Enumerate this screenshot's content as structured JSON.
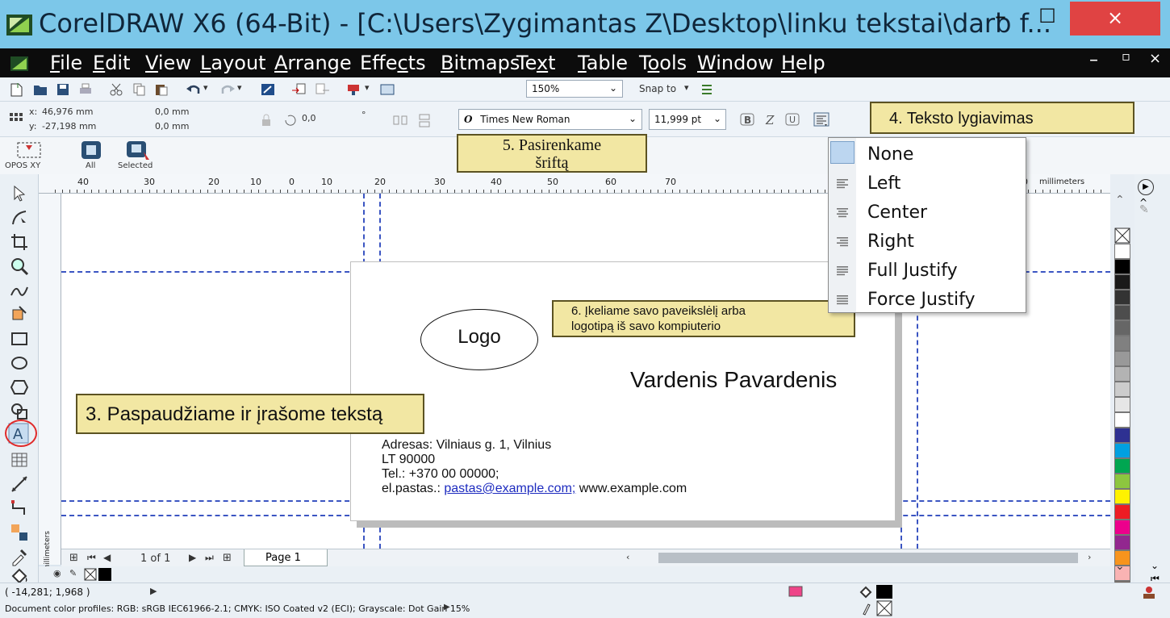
{
  "window": {
    "title": "CorelDRAW X6 (64-Bit) - [C:\\Users\\Zygimantas Z\\Desktop\\linku tekstai\\darb f...",
    "minimize": "–",
    "maximize": "☐",
    "close": "×"
  },
  "menu": {
    "items": [
      "File",
      "Edit",
      "View",
      "Layout",
      "Arrange",
      "Effects",
      "Bitmaps",
      "Text",
      "Table",
      "Tools",
      "Window",
      "Help"
    ],
    "mnemonics": [
      "F",
      "E",
      "V",
      "L",
      "A",
      "c",
      "B",
      "x",
      "T",
      "o",
      "W",
      "H"
    ],
    "doc_min": "–",
    "doc_restore": "▫",
    "doc_close": "×"
  },
  "standard_toolbar": {
    "zoom": "150%",
    "snap_to": "Snap to"
  },
  "property_bar": {
    "x_label": "x:",
    "x_value": "46,976 mm",
    "y_label": "y:",
    "y_value": "-27,198 mm",
    "w_value": "0,0 mm",
    "h_value": "0,0 mm",
    "angle_value": "0,0",
    "degree": "°",
    "font_name": "Times New Roman",
    "font_size": "11,999 pt"
  },
  "macro_toolbar": {
    "opos_label": "OPOS XY",
    "all_label": "All",
    "selected_label": "Selected"
  },
  "ruler": {
    "h_ticks": [
      "40",
      "30",
      "20",
      "10",
      "0",
      "10",
      "20",
      "30",
      "40",
      "50",
      "60",
      "70",
      "10"
    ],
    "units": "millimeters",
    "v_units": "millimeters"
  },
  "card": {
    "logo": "Logo",
    "name": "Vardenis Pavardenis",
    "address_line1": "Adresas: Vilniaus g. 1, Vilnius",
    "address_line2": "LT 90000",
    "phone": "Tel.: +370 00 00000;",
    "email_label": "el.pastas.: ",
    "email_link": "pastas@example.com;",
    "website": " www.example.com"
  },
  "callouts": {
    "step3": "3. Paspaudžiame ir įrašome tekstą",
    "step4": "4. Teksto lygiavimas",
    "step5_line1": "5. Pasirenkame",
    "step5_line2": "šriftą",
    "step6_line1": "6. Įkeliame savo paveikslėlį arba",
    "step6_line2": "logotipą iš savo kompiuterio"
  },
  "alignment_menu": {
    "items": [
      "None",
      "Left",
      "Center",
      "Right",
      "Full Justify",
      "Force Justify"
    ]
  },
  "page_nav": {
    "page_count": "1 of 1",
    "page_tab": "Page 1"
  },
  "status": {
    "coords": "( -14,281; 1,968 )",
    "profiles": "Document color profiles: RGB: sRGB IEC61966-2.1; CMYK: ISO Coated v2 (ECI); Grayscale: Dot Gain 15%"
  },
  "colors": {
    "titlebar": "#7cc7e9",
    "menubar": "#0c0c0c",
    "callout_fill": "#f2e7a3",
    "guide": "#3b55c2",
    "close_btn": "#e04343",
    "palette": [
      "#ffffff",
      "#000000",
      "#1a1a1a",
      "#333333",
      "#4d4d4d",
      "#666666",
      "#808080",
      "#999999",
      "#b3b3b3",
      "#cccccc",
      "#e6e6e6",
      "#ffffff",
      "#2e3192",
      "#00a0e0",
      "#00a651",
      "#8dc63f",
      "#fff200",
      "#ed1c24",
      "#ec008c",
      "#92278f",
      "#f7941d",
      "#f9b3b3",
      "#736357"
    ]
  }
}
